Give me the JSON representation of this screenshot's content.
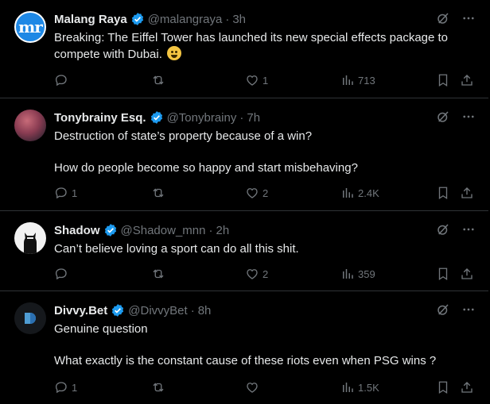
{
  "colors": {
    "accent": "#1d9bf0",
    "muted": "#71767b",
    "border": "#2f3336",
    "text": "#e7e9ea"
  },
  "tweets": [
    {
      "name": "Malang Raya",
      "handle": "@malangraya",
      "dot": "·",
      "time": "3h",
      "avatar_text": "mr",
      "lines": [
        "Breaking: The Eiffel Tower has launched its new special effects package to",
        "compete with Dubai."
      ],
      "emoji": "crying-face",
      "replies": "",
      "retweets": "",
      "likes": "1",
      "views": "713"
    },
    {
      "name": "Tonybrainy Esq.",
      "handle": "@Tonybrainy",
      "dot": "·",
      "time": "7h",
      "lines": [
        "Destruction of state’s property because of a win?",
        "How do people become so happy and start misbehaving?"
      ],
      "replies": "1",
      "retweets": "",
      "likes": "2",
      "views": "2.4K"
    },
    {
      "name": "Shadow",
      "handle": "@Shadow_mnn",
      "dot": "·",
      "time": "2h",
      "lines": [
        "Can’t believe loving a sport can do all this shit."
      ],
      "replies": "",
      "retweets": "",
      "likes": "2",
      "views": "359"
    },
    {
      "name": "Divvy.Bet",
      "handle": "@DivvyBet",
      "dot": "·",
      "time": "8h",
      "lines": [
        "Genuine question",
        "What exactly is the constant cause of these riots even when PSG wins ?"
      ],
      "replies": "1",
      "retweets": "",
      "likes": "",
      "views": "1.5K"
    }
  ]
}
